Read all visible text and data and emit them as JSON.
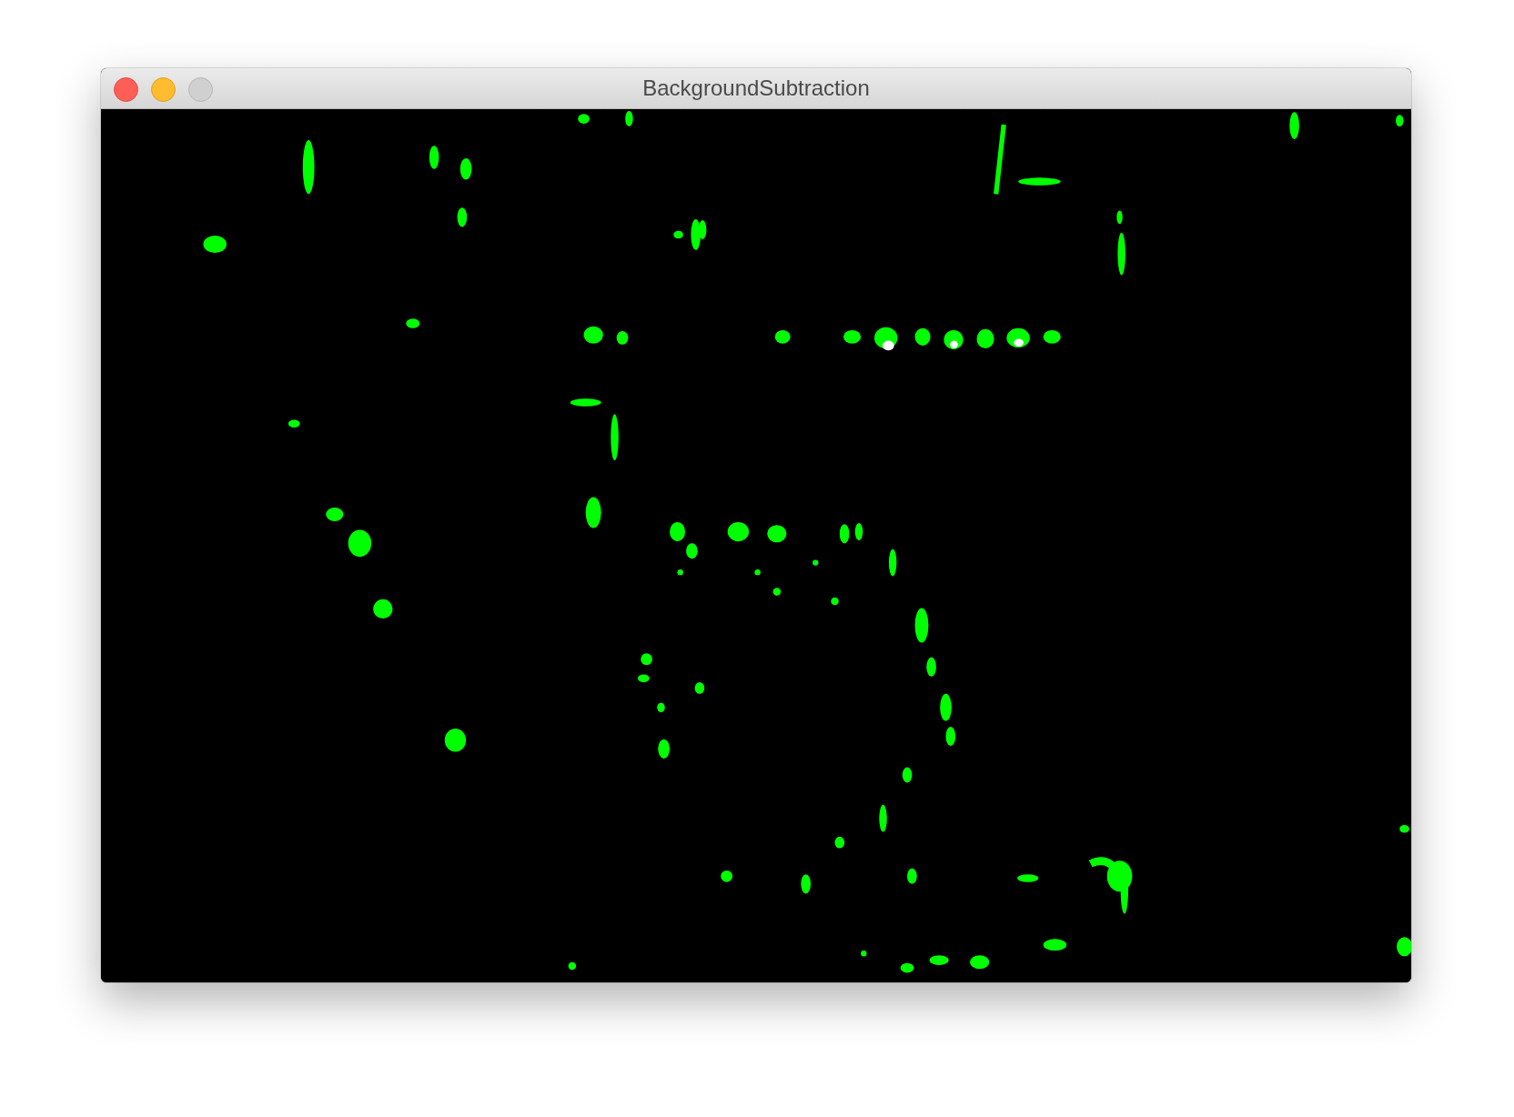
{
  "window": {
    "title": "BackgroundSubtraction"
  }
}
